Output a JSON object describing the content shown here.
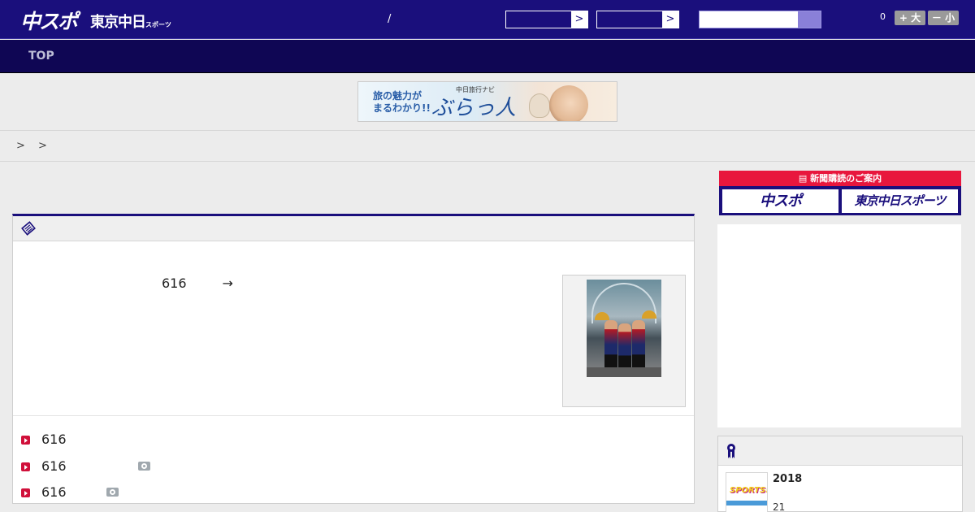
{
  "header": {
    "logo_main": "中スポ",
    "logo_sub": "東京中日",
    "logo_sub_small": "スポーツ",
    "date_separator": "/",
    "select_arrow": ">",
    "font_size_count": "0",
    "font_bigger_label": "+ 大",
    "font_smaller_label": "－ 小"
  },
  "nav": {
    "items": [
      {
        "label": "TOP"
      }
    ]
  },
  "banner": {
    "catch": "旅の魅力が\nまるわかり!!",
    "nav_label": "中日旅行ナビ",
    "brand": "ぶらっ人"
  },
  "breadcrumb": {
    "text": "> >"
  },
  "article": {
    "number": "616",
    "arrow": "→",
    "related": [
      {
        "label": "616",
        "has_photo": false
      },
      {
        "label": "616",
        "has_photo": true
      },
      {
        "label": "616",
        "has_photo": true
      }
    ]
  },
  "sidebar": {
    "subscribe_header": "新聞購読のご案内",
    "subscribe_btn_1": "中スポ",
    "subscribe_btn_2": "東京中日スポーツ",
    "ranking": {
      "thumb_text": "SPORTS!!",
      "year": "2018",
      "number": "21"
    }
  },
  "colors": {
    "header_bg": "#1a0f7c",
    "nav_bg": "#0f0654",
    "accent_red": "#d0103a",
    "subscribe_red": "#e8173d"
  }
}
